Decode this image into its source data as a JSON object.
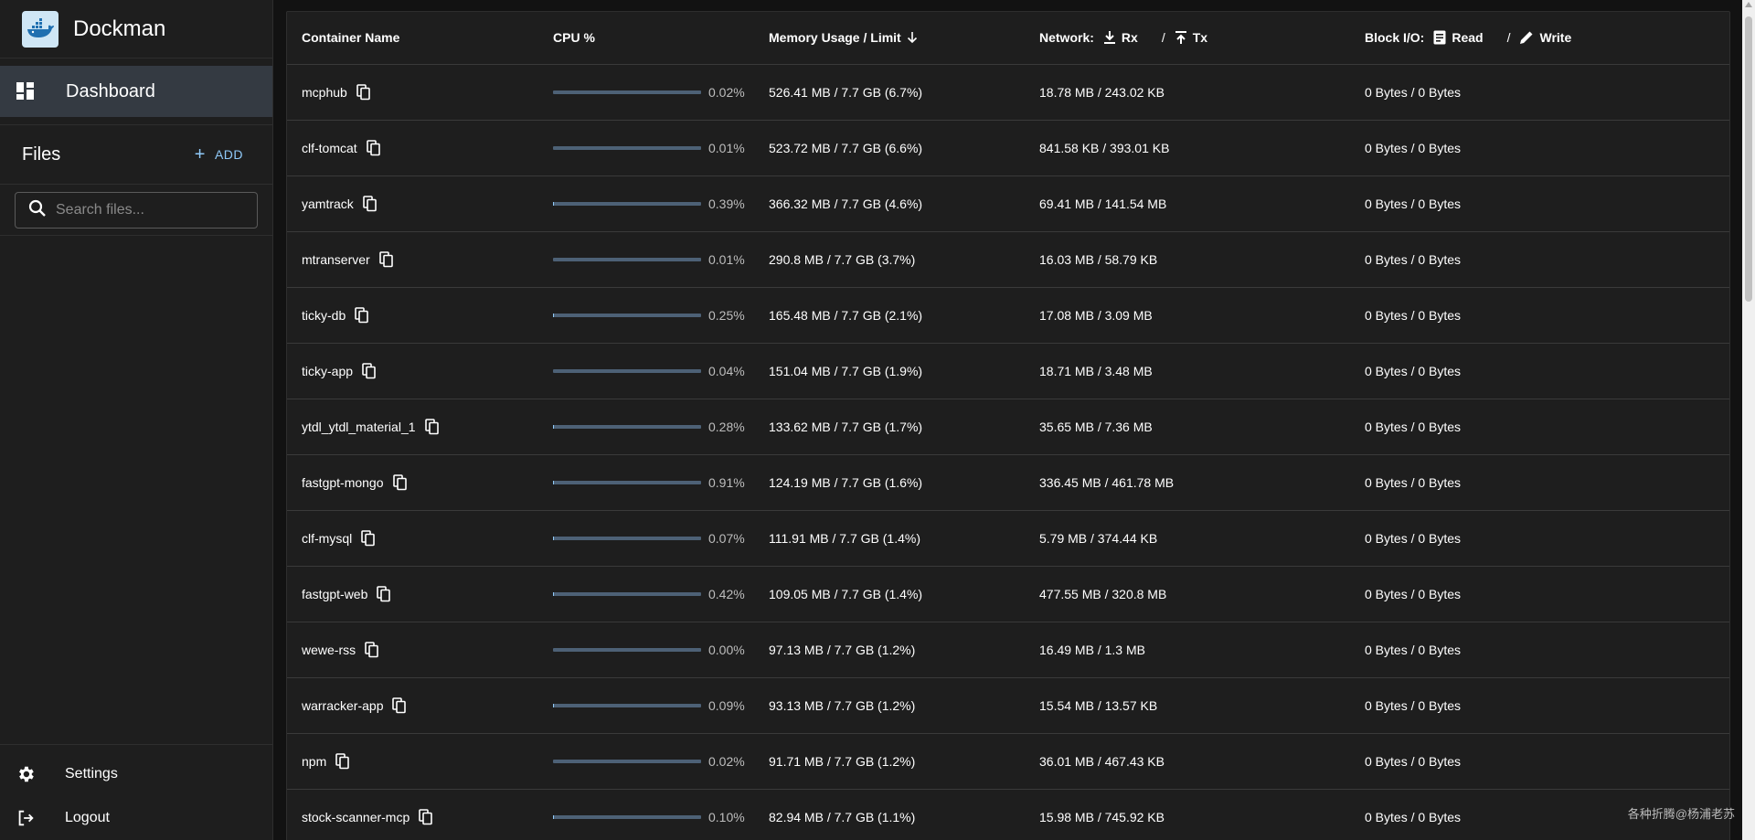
{
  "app": {
    "title": "Dockman"
  },
  "nav": {
    "dashboard_label": "Dashboard"
  },
  "files": {
    "label": "Files",
    "add_label": "ADD",
    "search_placeholder": "Search files..."
  },
  "bottom": {
    "settings_label": "Settings",
    "logout_label": "Logout"
  },
  "table": {
    "headers": {
      "name": "Container Name",
      "cpu": "CPU %",
      "memory": "Memory Usage / Limit",
      "network": "Network:",
      "rx": "Rx",
      "tx": "Tx",
      "block": "Block I/O:",
      "read": "Read",
      "write": "Write",
      "slash": "/"
    },
    "rows": [
      {
        "name": "mcphub",
        "cpu": "0.02%",
        "cpu_frac": 0.0002,
        "mem": "526.41 MB / 7.7 GB (6.7%)",
        "net": "18.78 MB / 243.02 KB",
        "block": "0 Bytes / 0 Bytes"
      },
      {
        "name": "clf-tomcat",
        "cpu": "0.01%",
        "cpu_frac": 0.0001,
        "mem": "523.72 MB / 7.7 GB (6.6%)",
        "net": "841.58 KB / 393.01 KB",
        "block": "0 Bytes / 0 Bytes"
      },
      {
        "name": "yamtrack",
        "cpu": "0.39%",
        "cpu_frac": 0.0039,
        "mem": "366.32 MB / 7.7 GB (4.6%)",
        "net": "69.41 MB / 141.54 MB",
        "block": "0 Bytes / 0 Bytes"
      },
      {
        "name": "mtranserver",
        "cpu": "0.01%",
        "cpu_frac": 0.0001,
        "mem": "290.8 MB / 7.7 GB (3.7%)",
        "net": "16.03 MB / 58.79 KB",
        "block": "0 Bytes / 0 Bytes"
      },
      {
        "name": "ticky-db",
        "cpu": "0.25%",
        "cpu_frac": 0.0025,
        "mem": "165.48 MB / 7.7 GB (2.1%)",
        "net": "17.08 MB / 3.09 MB",
        "block": "0 Bytes / 0 Bytes"
      },
      {
        "name": "ticky-app",
        "cpu": "0.04%",
        "cpu_frac": 0.0004,
        "mem": "151.04 MB / 7.7 GB (1.9%)",
        "net": "18.71 MB / 3.48 MB",
        "block": "0 Bytes / 0 Bytes"
      },
      {
        "name": "ytdl_ytdl_material_1",
        "cpu": "0.28%",
        "cpu_frac": 0.0028,
        "mem": "133.62 MB / 7.7 GB (1.7%)",
        "net": "35.65 MB / 7.36 MB",
        "block": "0 Bytes / 0 Bytes"
      },
      {
        "name": "fastgpt-mongo",
        "cpu": "0.91%",
        "cpu_frac": 0.0091,
        "mem": "124.19 MB / 7.7 GB (1.6%)",
        "net": "336.45 MB / 461.78 MB",
        "block": "0 Bytes / 0 Bytes"
      },
      {
        "name": "clf-mysql",
        "cpu": "0.07%",
        "cpu_frac": 0.0007,
        "mem": "111.91 MB / 7.7 GB (1.4%)",
        "net": "5.79 MB / 374.44 KB",
        "block": "0 Bytes / 0 Bytes"
      },
      {
        "name": "fastgpt-web",
        "cpu": "0.42%",
        "cpu_frac": 0.0042,
        "mem": "109.05 MB / 7.7 GB (1.4%)",
        "net": "477.55 MB / 320.8 MB",
        "block": "0 Bytes / 0 Bytes"
      },
      {
        "name": "wewe-rss",
        "cpu": "0.00%",
        "cpu_frac": 0.0,
        "mem": "97.13 MB / 7.7 GB (1.2%)",
        "net": "16.49 MB / 1.3 MB",
        "block": "0 Bytes / 0 Bytes"
      },
      {
        "name": "warracker-app",
        "cpu": "0.09%",
        "cpu_frac": 0.0009,
        "mem": "93.13 MB / 7.7 GB (1.2%)",
        "net": "15.54 MB / 13.57 KB",
        "block": "0 Bytes / 0 Bytes"
      },
      {
        "name": "npm",
        "cpu": "0.02%",
        "cpu_frac": 0.0002,
        "mem": "91.71 MB / 7.7 GB (1.2%)",
        "net": "36.01 MB / 467.43 KB",
        "block": "0 Bytes / 0 Bytes"
      },
      {
        "name": "stock-scanner-mcp",
        "cpu": "0.10%",
        "cpu_frac": 0.001,
        "mem": "82.94 MB / 7.7 GB (1.1%)",
        "net": "15.98 MB / 745.92 KB",
        "block": "0 Bytes / 0 Bytes"
      }
    ]
  },
  "watermark": "各种折腾@杨浦老苏",
  "colors": {
    "accent": "#90caf9",
    "sidebar_bg": "#1e1e1e",
    "selected_bg": "#343a42",
    "page_bg": "#121212"
  }
}
